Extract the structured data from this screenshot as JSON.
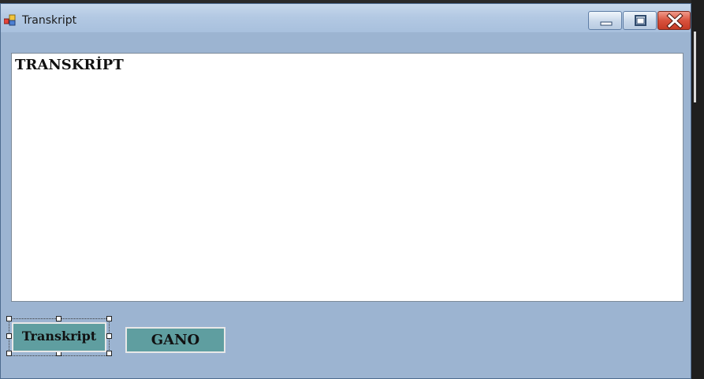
{
  "window": {
    "title": "Transkript",
    "icon": "windows-form-icon",
    "controls": [
      "minimize-icon",
      "maximize-icon",
      "close-icon"
    ]
  },
  "output": {
    "text": "TRANSKRİPT"
  },
  "buttons": {
    "transkript_label": "Transkript",
    "gano_label": "GANO"
  },
  "colors": {
    "client_background": "#9cb4d1",
    "button_face": "#5f9ea0",
    "close_button": "#c63b25"
  }
}
